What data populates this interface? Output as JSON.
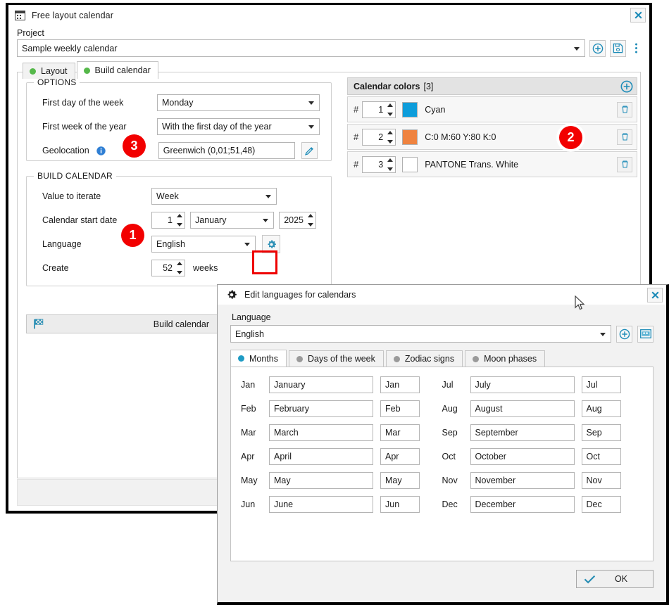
{
  "main_window": {
    "title": "Free layout calendar",
    "icon": "calendar-icon",
    "close_label": "X",
    "project": {
      "label": "Project",
      "value": "Sample weekly calendar",
      "buttons": [
        {
          "name": "add-project-button",
          "icon": "plus-circle-icon"
        },
        {
          "name": "save-project-button",
          "icon": "floppy-disk-icon"
        },
        {
          "name": "project-more-button",
          "icon": "vertical-dots-icon"
        }
      ]
    },
    "tabs": [
      {
        "label": "Layout",
        "active": false,
        "dot": "#55b84a"
      },
      {
        "label": "Build calendar",
        "active": true,
        "dot": "#55b84a"
      }
    ]
  },
  "options_group": {
    "legend": "OPTIONS",
    "rows": [
      {
        "label": "First day of the week",
        "value": "Monday",
        "control": "combo"
      },
      {
        "label": "First week of the year",
        "value": "With the first day of the year",
        "control": "combo"
      },
      {
        "label": "Geolocation",
        "value": "Greenwich (0,01;51,48)",
        "control": "textbox",
        "info_icon": "info-icon",
        "edit_icon": "pencil-icon"
      }
    ]
  },
  "build_group": {
    "legend": "BUILD CALENDAR",
    "value_to_iterate": {
      "label": "Value to iterate",
      "value": "Week"
    },
    "start_date": {
      "label": "Calendar start date",
      "day": "1",
      "month": "January",
      "year": "2025"
    },
    "language": {
      "label": "Language",
      "value": "English",
      "settings_icon": "gear-icon"
    },
    "create": {
      "label": "Create",
      "count": "52",
      "unit": "weeks"
    }
  },
  "build_button": {
    "label": "Build calendar",
    "icon": "checkered-flag-icon"
  },
  "colors_panel": {
    "title": "Calendar colors",
    "count": "[3]",
    "add_icon": "plus-circle-icon",
    "rows": [
      {
        "index": "1",
        "swatch": "#0d9ddb",
        "name": "Cyan",
        "delete_icon": "trash-icon"
      },
      {
        "index": "2",
        "swatch": "#ef8340",
        "name": "C:0 M:60 Y:80 K:0",
        "delete_icon": "trash-icon"
      },
      {
        "index": "3",
        "swatch": "#ffffff",
        "name": "PANTONE Trans. White",
        "delete_icon": "trash-icon"
      }
    ]
  },
  "markers": [
    {
      "id": "1",
      "label": "1"
    },
    {
      "id": "2",
      "label": "2"
    },
    {
      "id": "3",
      "label": "3"
    }
  ],
  "dialog": {
    "title": "Edit languages for calendars",
    "icon": "gear-icon",
    "close_label": "X",
    "language_label": "Language",
    "language_value": "English",
    "buttons": [
      {
        "name": "add-language-button",
        "icon": "plus-circle-icon"
      },
      {
        "name": "language-card-button",
        "icon": "card-icon"
      }
    ],
    "tabs": [
      {
        "label": "Months",
        "active": true
      },
      {
        "label": "Days of the week",
        "active": false
      },
      {
        "label": "Zodiac signs",
        "active": false
      },
      {
        "label": "Moon phases",
        "active": false
      }
    ],
    "months_left": [
      {
        "abbr_label": "Jan",
        "full": "January",
        "short": "Jan"
      },
      {
        "abbr_label": "Feb",
        "full": "February",
        "short": "Feb"
      },
      {
        "abbr_label": "Mar",
        "full": "March",
        "short": "Mar"
      },
      {
        "abbr_label": "Apr",
        "full": "April",
        "short": "Apr"
      },
      {
        "abbr_label": "May",
        "full": "May",
        "short": "May"
      },
      {
        "abbr_label": "Jun",
        "full": "June",
        "short": "Jun"
      }
    ],
    "months_right": [
      {
        "abbr_label": "Jul",
        "full": "July",
        "short": "Jul"
      },
      {
        "abbr_label": "Aug",
        "full": "August",
        "short": "Aug"
      },
      {
        "abbr_label": "Sep",
        "full": "September",
        "short": "Sep"
      },
      {
        "abbr_label": "Oct",
        "full": "October",
        "short": "Oct"
      },
      {
        "abbr_label": "Nov",
        "full": "November",
        "short": "Nov"
      },
      {
        "abbr_label": "Dec",
        "full": "December",
        "short": "Dec"
      }
    ],
    "ok_label": "OK",
    "ok_icon": "check-icon"
  },
  "accents": {
    "teal": "#1e8cb8",
    "green_dot": "#55b84a",
    "marker_red": "#f20000",
    "highlight_red": "#ee0000"
  }
}
